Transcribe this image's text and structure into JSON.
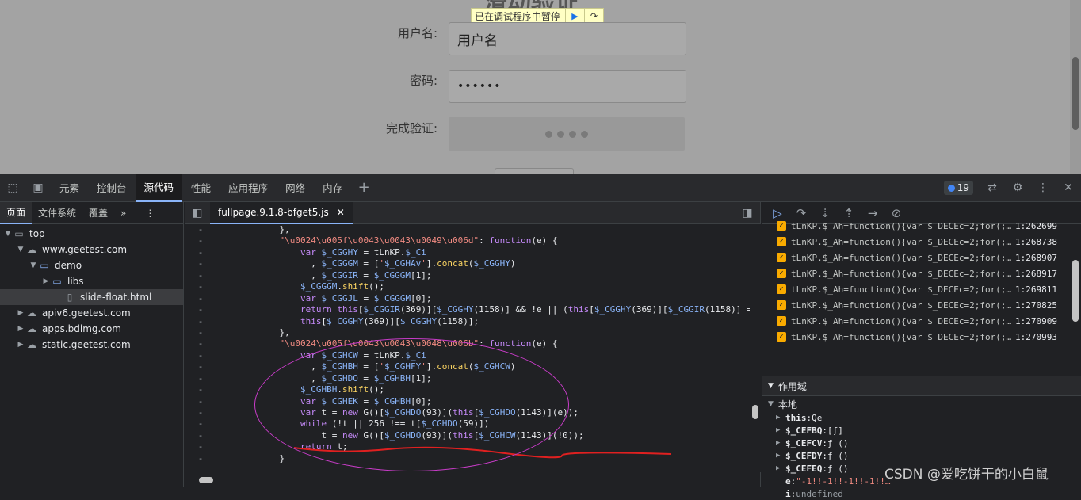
{
  "page": {
    "paused_text": "已在调试程序中暂停",
    "username_label": "用户名:",
    "username_value": "用户名",
    "password_label": "密码:",
    "password_value": "••••••",
    "verify_label": "完成验证:"
  },
  "devtools": {
    "tabs": [
      "元素",
      "控制台",
      "源代码",
      "性能",
      "应用程序",
      "网络",
      "内存"
    ],
    "active_tab": "源代码",
    "issue_count": "19",
    "left_tabs": [
      "页面",
      "文件系统",
      "覆盖"
    ],
    "tree": [
      {
        "label": "top",
        "depth": 0,
        "icon": "window-icon",
        "arrow": "▼"
      },
      {
        "label": "www.geetest.com",
        "depth": 1,
        "icon": "cloud-icon",
        "arrow": "▼"
      },
      {
        "label": "demo",
        "depth": 2,
        "icon": "folder-icon",
        "arrow": "▼"
      },
      {
        "label": "libs",
        "depth": 3,
        "icon": "folder-icon",
        "arrow": "▶"
      },
      {
        "label": "slide-float.html",
        "depth": 4,
        "icon": "file-icon",
        "arrow": "",
        "selected": true
      },
      {
        "label": "apiv6.geetest.com",
        "depth": 1,
        "icon": "cloud-icon",
        "arrow": "▶"
      },
      {
        "label": "apps.bdimg.com",
        "depth": 1,
        "icon": "cloud-icon",
        "arrow": "▶"
      },
      {
        "label": "static.geetest.com",
        "depth": 1,
        "icon": "cloud-icon",
        "arrow": "▶"
      }
    ],
    "file_tab": "fullpage.9.1.8-bfget5.js",
    "code_lines": [
      "            },",
      "            \"\\u0024\\u005f\\u0043\\u0043\\u0049\\u006d\": function(e) {",
      "                var $_CGGHY = tLnKP.$_Ci",
      "                  , $_CGGGM = ['$_CGHAv'].concat($_CGGHY)",
      "                  , $_CGGIR = $_CGGGM[1];",
      "                $_CGGGM.shift();",
      "                var $_CGGJL = $_CGGGM[0];",
      "                return this[$_CGGIR(369)][$_CGGHY(1158)] && !e || (this[$_CGGHY(369)][$_CGGIR(1158)] =",
      "                this[$_CGGHY(369)][$_CGGHY(1158)];",
      "            },",
      "            \"\\u0024\\u005f\\u0043\\u0043\\u0048\\u006b\": function(e) {",
      "                var $_CGHCW = tLnKP.$_Ci",
      "                  , $_CGHBH = ['$_CGHFY'].concat($_CGHCW)",
      "                  , $_CGHDO = $_CGHBH[1];",
      "                $_CGHBH.shift();",
      "                var $_CGHEK = $_CGHBH[0];",
      "                var t = new G()[$_CGHDO(93)](this[$_CGHDO(1143)](e));",
      "                while (!t || 256 !== t[$_CGHDO(59)])",
      "                    t = new G()[$_CGHDO(93)](this[$_CGHCW(1143)](!0));",
      "                return t;",
      "            }"
    ],
    "breakpoints": [
      {
        "text": "tLnKP.$_Ah=function(){var $_DECEc=2;for(;…",
        "line": "1:262699"
      },
      {
        "text": "tLnKP.$_Ah=function(){var $_DECEc=2;for(;…",
        "line": "1:268738"
      },
      {
        "text": "tLnKP.$_Ah=function(){var $_DECEc=2;for(;…",
        "line": "1:268907"
      },
      {
        "text": "tLnKP.$_Ah=function(){var $_DECEc=2;for(;…",
        "line": "1:268917"
      },
      {
        "text": "tLnKP.$_Ah=function(){var $_DECEc=2;for(;…",
        "line": "1:269811"
      },
      {
        "text": "tLnKP.$_Ah=function(){var $_DECEc=2;for(;…",
        "line": "1:270825"
      },
      {
        "text": "tLnKP.$_Ah=function(){var $_DECEc=2;for(;…",
        "line": "1:270909"
      },
      {
        "text": "tLnKP.$_Ah=function(){var $_DECEc=2;for(;…",
        "line": "1:270993"
      }
    ],
    "scope_title": "作用域",
    "local_title": "本地",
    "scope_vars": [
      {
        "key": "this",
        "value": "Qe",
        "arrow": "▶"
      },
      {
        "key": "$_CEFBQ",
        "value": "[ƒ]",
        "arrow": "▶"
      },
      {
        "key": "$_CEFCV",
        "value": "ƒ ()",
        "arrow": "▶"
      },
      {
        "key": "$_CEFDY",
        "value": "ƒ ()",
        "arrow": "▶"
      },
      {
        "key": "$_CEFEQ",
        "value": "ƒ ()",
        "arrow": "▶"
      },
      {
        "key": "e",
        "value": "\"-1!!-1!!-1!!-1!!…",
        "arrow": ""
      },
      {
        "key": "i",
        "value": "undefined",
        "arrow": ""
      }
    ]
  },
  "watermark": "CSDN @爱吃饼干的小白鼠"
}
